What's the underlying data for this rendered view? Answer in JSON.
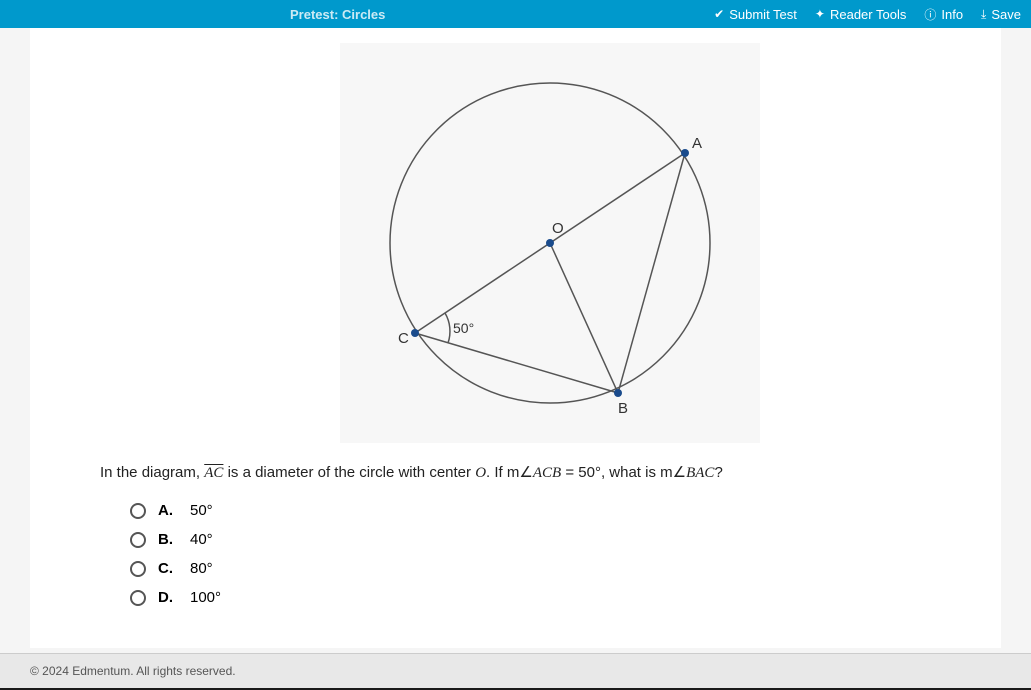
{
  "header": {
    "title": "Pretest: Circles",
    "submit": "Submit Test",
    "reader": "Reader Tools",
    "info": "Info",
    "save": "Save"
  },
  "diagram": {
    "labels": {
      "A": "A",
      "B": "B",
      "C": "C",
      "O": "O"
    },
    "angle": "50°"
  },
  "question": {
    "prefix": "In the diagram, ",
    "segment": "AC",
    "middle": " is a diameter of the circle with center ",
    "center": "O",
    "cond_prefix": ". If m",
    "angle_sym": "∠",
    "cond_angle": "ACB",
    "cond_val": " = 50°, what is m",
    "ask_angle": "BAC",
    "suffix": "?"
  },
  "options": [
    {
      "letter": "A.",
      "value": "50°"
    },
    {
      "letter": "B.",
      "value": "40°"
    },
    {
      "letter": "C.",
      "value": "80°"
    },
    {
      "letter": "D.",
      "value": "100°"
    }
  ],
  "footer": "© 2024 Edmentum. All rights reserved."
}
